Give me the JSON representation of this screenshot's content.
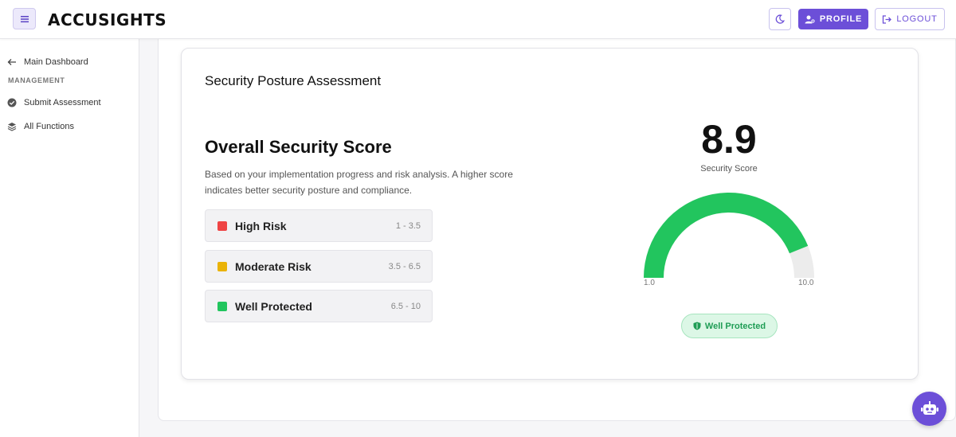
{
  "header": {
    "logo": "ACCUSIGHTS",
    "profile_label": "PROFILE",
    "logout_label": "LOGOUT",
    "accent": "#6c4fd8"
  },
  "sidebar": {
    "back_item": {
      "label": "Main Dashboard",
      "icon": "arrow-left-icon"
    },
    "section_heading": "MANAGEMENT",
    "items": [
      {
        "label": "Submit Assessment",
        "icon": "check-circle-icon"
      },
      {
        "label": "All Functions",
        "icon": "layers-icon"
      }
    ]
  },
  "main": {
    "card_title": "Security Posture Assessment",
    "score_heading": "Overall Security Score",
    "description": "Based on your implementation progress and risk analysis. A higher score indicates better security posture and compliance.",
    "risk_levels": [
      {
        "label": "High Risk",
        "range": "1 - 3.5",
        "color": "#ef4444"
      },
      {
        "label": "Moderate Risk",
        "range": "3.5 - 6.5",
        "color": "#eab308"
      },
      {
        "label": "Well Protected",
        "range": "6.5 - 10",
        "color": "#22c55e"
      }
    ],
    "score": {
      "value": "8.9",
      "caption": "Security Score",
      "min_label": "1.0",
      "max_label": "10.0",
      "gauge_fill_color": "#22c55e",
      "status": "Well Protected"
    }
  }
}
